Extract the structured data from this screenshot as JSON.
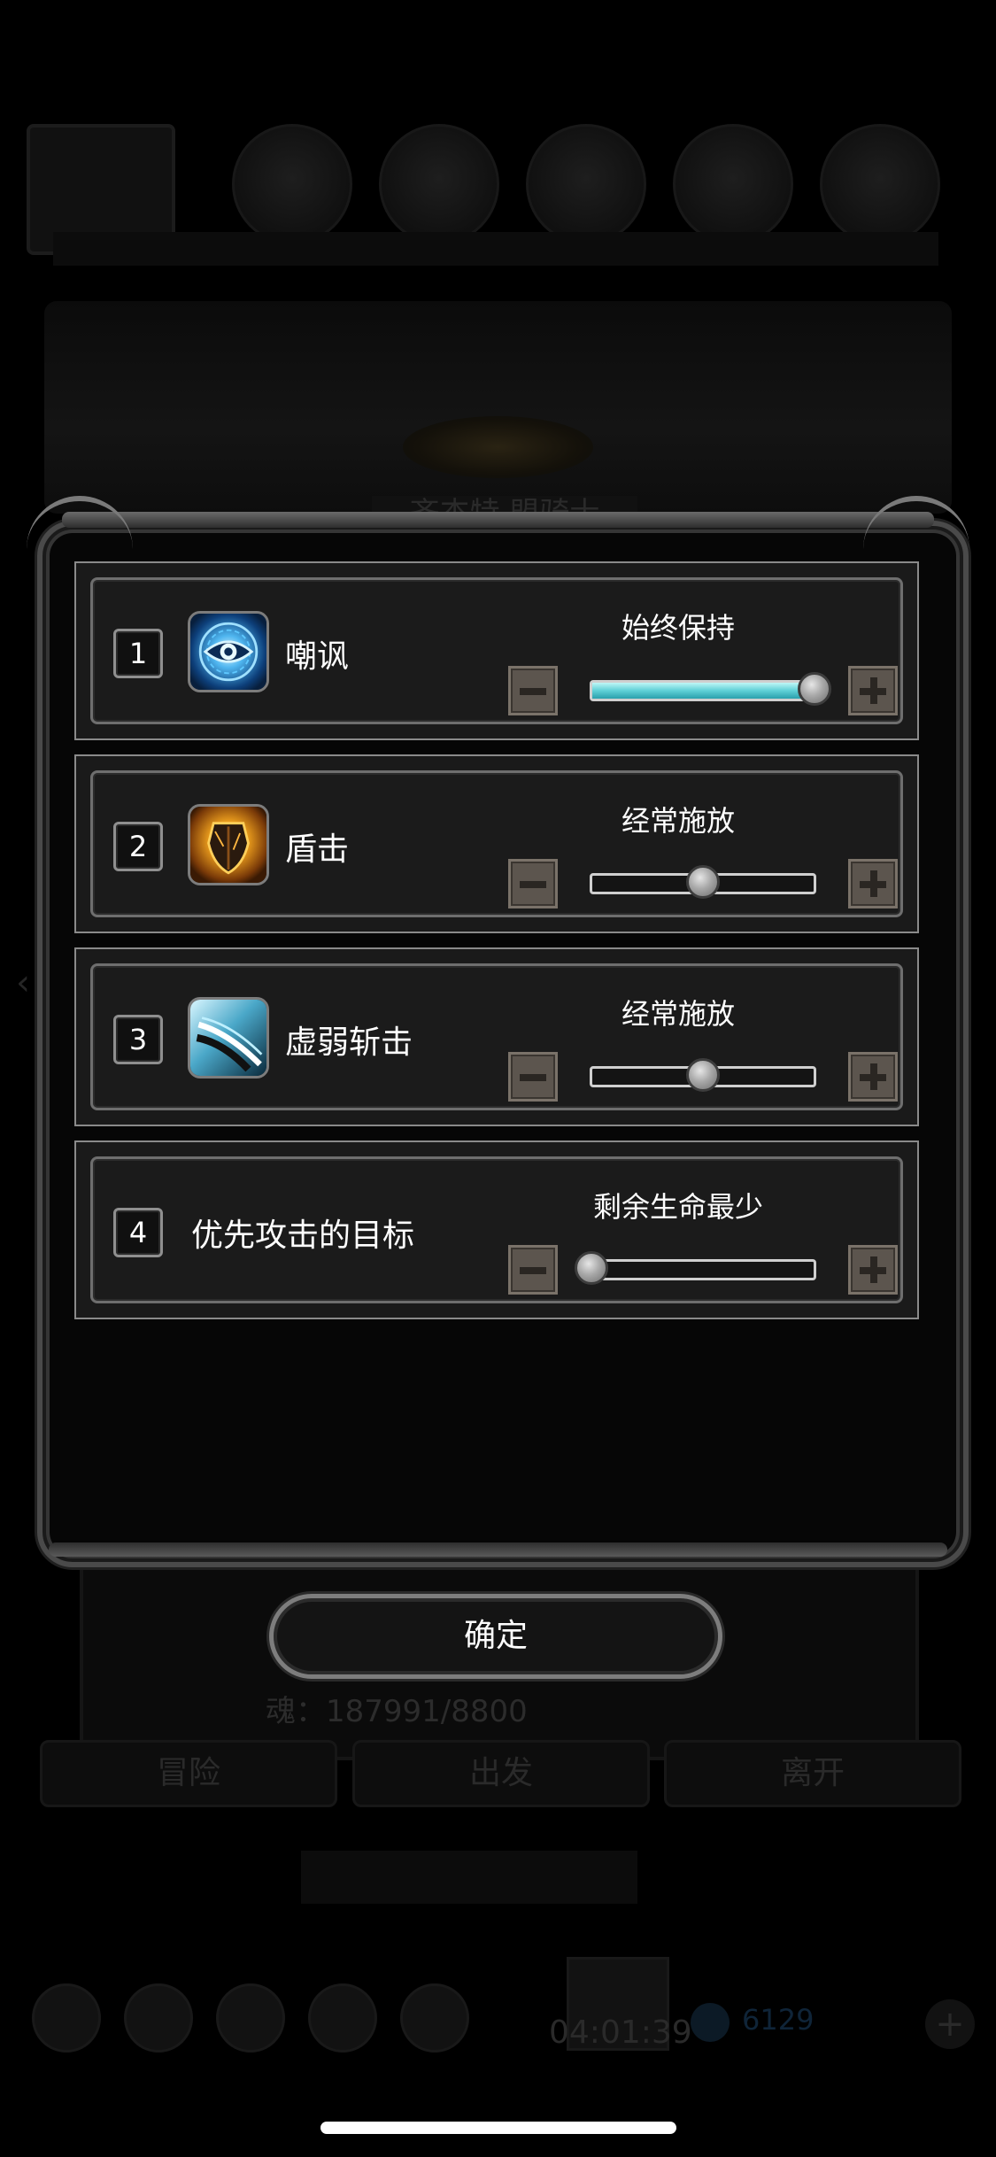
{
  "background": {
    "soul_text": "魂：187991/8800",
    "bottom_buttons": [
      "冒险",
      "出发",
      "离开"
    ],
    "subtitle": "齐杰特 盟骑士",
    "timer": "04:01:39",
    "gems": "6129",
    "plus_glyph": "+",
    "arrow_left": "‹",
    "arrow_right": "›"
  },
  "skills": [
    {
      "index": "1",
      "name": "嘲讽",
      "icon": "eye-icon",
      "frequency": "始终保持",
      "level": 1.0,
      "fill": true
    },
    {
      "index": "2",
      "name": "盾击",
      "icon": "shield-icon",
      "frequency": "经常施放",
      "level": 0.5,
      "fill": false
    },
    {
      "index": "3",
      "name": "虚弱斩击",
      "icon": "slash-icon",
      "frequency": "经常施放",
      "level": 0.5,
      "fill": false
    },
    {
      "index": "4",
      "name": "优先攻击的目标",
      "icon": "",
      "frequency": "剩余生命最少",
      "level": 0.0,
      "fill": false
    }
  ],
  "confirm_label": "确定",
  "colors": {
    "slider_fill": "#5fd0d6",
    "step_button": "#5c554e",
    "frame": "#8a8a8a"
  }
}
